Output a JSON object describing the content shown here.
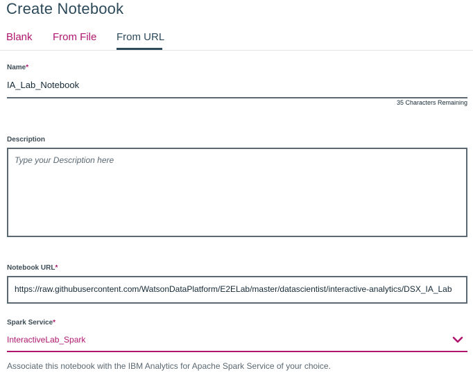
{
  "page": {
    "title": "Create Notebook"
  },
  "tabs": [
    {
      "label": "Blank"
    },
    {
      "label": "From File"
    },
    {
      "label": "From URL"
    }
  ],
  "form": {
    "name": {
      "label": "Name",
      "required_mark": "*",
      "value": "IA_Lab_Notebook",
      "remaining": "35 Characters Remaining"
    },
    "description": {
      "label": "Description",
      "placeholder": "Type your Description here"
    },
    "notebook_url": {
      "label": "Notebook URL",
      "required_mark": "*",
      "value": "https://raw.githubusercontent.com/WatsonDataPlatform/E2ELab/master/datascientist/interactive-analytics/DSX_IA_Lab"
    },
    "spark_service": {
      "label": "Spark Service",
      "required_mark": "*",
      "selected": "InteractiveLab_Spark",
      "helper": "Associate this notebook with the IBM Analytics for Apache Spark Service of your choice."
    }
  },
  "icons": {
    "dropdown": "chevron-down-icon"
  },
  "colors": {
    "accent": "#b0166e",
    "title": "#2d4a5a",
    "border": "#5a6872"
  }
}
